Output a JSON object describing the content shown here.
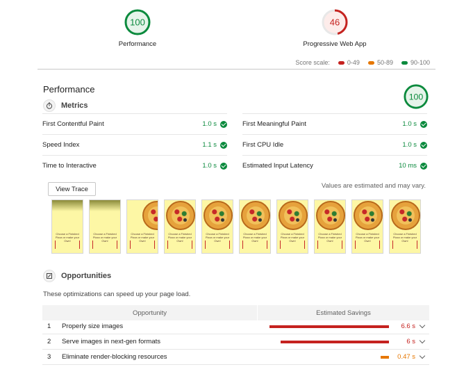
{
  "colors": {
    "pass": "#0b8a3d",
    "average": "#e67700",
    "fail": "#c5221f",
    "gauge_track": "#e8e8e8",
    "pass_fill": "#e6f4ea",
    "fail_fill": "#fdecea"
  },
  "categories": [
    {
      "label": "Performance",
      "score": "100",
      "score_value": 100
    },
    {
      "label": "Progressive Web App",
      "score": "46",
      "score_value": 46
    }
  ],
  "scale": {
    "label": "Score scale:",
    "fail": "0-49",
    "average": "50-89",
    "pass": "90-100"
  },
  "performance": {
    "title": "Performance",
    "score": "100",
    "score_value": 100,
    "metrics_title": "Metrics",
    "metrics": [
      {
        "name": "First Contentful Paint",
        "value": "1.0 s"
      },
      {
        "name": "First Meaningful Paint",
        "value": "1.0 s"
      },
      {
        "name": "Speed Index",
        "value": "1.1 s"
      },
      {
        "name": "First CPU Idle",
        "value": "1.0 s"
      },
      {
        "name": "Time to Interactive",
        "value": "1.0 s"
      },
      {
        "name": "Estimated Input Latency",
        "value": "10 ms"
      }
    ],
    "view_trace": "View Trace",
    "note": "Values are estimated and may vary.",
    "filmstrip_caption": "Choose a Finished Pizza\nor make your Own!"
  },
  "opportunities": {
    "title": "Opportunities",
    "description": "These optimizations can speed up your page load.",
    "col_opportunity": "Opportunity",
    "col_savings": "Estimated Savings",
    "max_savings_s": 6.6,
    "items": [
      {
        "index": "1",
        "name": "Properly size images",
        "saving": "6.6 s",
        "saving_s": 6.6,
        "status": "fail"
      },
      {
        "index": "2",
        "name": "Serve images in next-gen formats",
        "saving": "6 s",
        "saving_s": 6.0,
        "status": "fail"
      },
      {
        "index": "3",
        "name": "Eliminate render-blocking resources",
        "saving": "0.47 s",
        "saving_s": 0.47,
        "status": "average"
      }
    ]
  }
}
